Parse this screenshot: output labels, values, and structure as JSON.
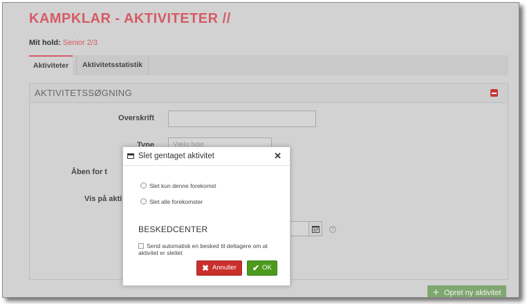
{
  "page": {
    "title": "KAMPKLAR - AKTIVITETER //",
    "team_label": "Mit hold:",
    "team_value": "Senior 2/3"
  },
  "tabs": [
    {
      "label": "Aktiviteter",
      "active": true
    },
    {
      "label": "Aktivitetsstatistik",
      "active": false
    }
  ],
  "search_panel": {
    "title": "AKTIVITETSSØGNING",
    "fields": {
      "heading_label": "Overskrift",
      "heading_value": "",
      "type_label": "Type",
      "type_placeholder": "Vælg type",
      "open_for_label": "Åben for t",
      "show_on_label": "Vis på akti"
    }
  },
  "create_button": {
    "label": "Opret ny aktivitet",
    "icon": "plus-icon"
  },
  "dialog": {
    "title": "Slet gentaget aktivitet",
    "options": [
      {
        "label": "Slet kun denne forekomst",
        "checked": false
      },
      {
        "label": "Slet alle forekomster",
        "checked": false
      }
    ],
    "section_title": "BESKEDCENTER",
    "notify_label": "Send automatisk en besked til deltagere om at aktivitet er slettet",
    "notify_checked": false,
    "cancel_label": "Annuller",
    "ok_label": "OK"
  },
  "colors": {
    "accent": "#d55b65",
    "cancel": "#c9302c",
    "ok": "#4e9a1f",
    "create": "#7fa870"
  }
}
